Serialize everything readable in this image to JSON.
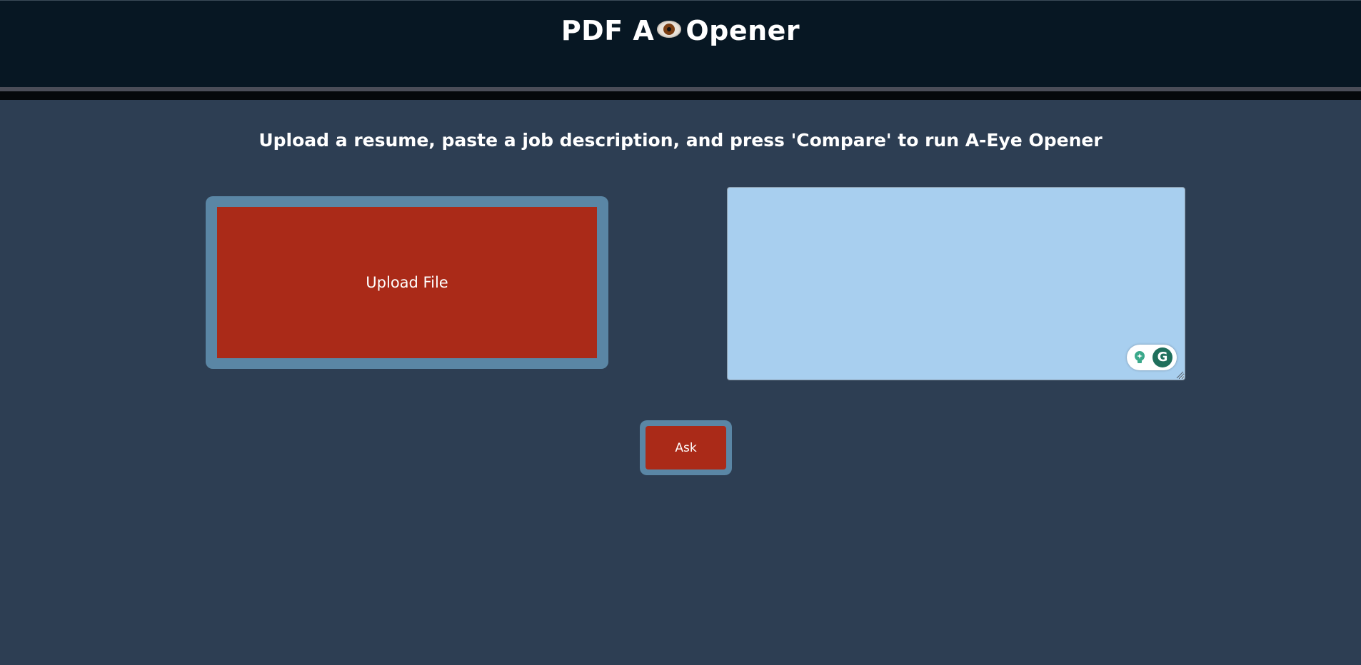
{
  "header": {
    "title_before": "PDF A",
    "title_after": "Opener",
    "title_icon": "eye-icon"
  },
  "instructions": "Upload a resume, paste a job description, and press 'Compare' to run A-Eye Opener",
  "upload": {
    "label": "Upload File"
  },
  "job_description": {
    "value": "",
    "placeholder": ""
  },
  "grammarly": {
    "icons": [
      "lightbulb-icon",
      "grammarly-g-icon"
    ],
    "g_letter": "G"
  },
  "ask_button": {
    "label": "Ask"
  },
  "colors": {
    "header_bg": "#071723",
    "page_bg": "#2d3e53",
    "button_red": "#aa2a18",
    "button_frame": "#5a86a5",
    "textarea_bg": "#a8cfef"
  }
}
